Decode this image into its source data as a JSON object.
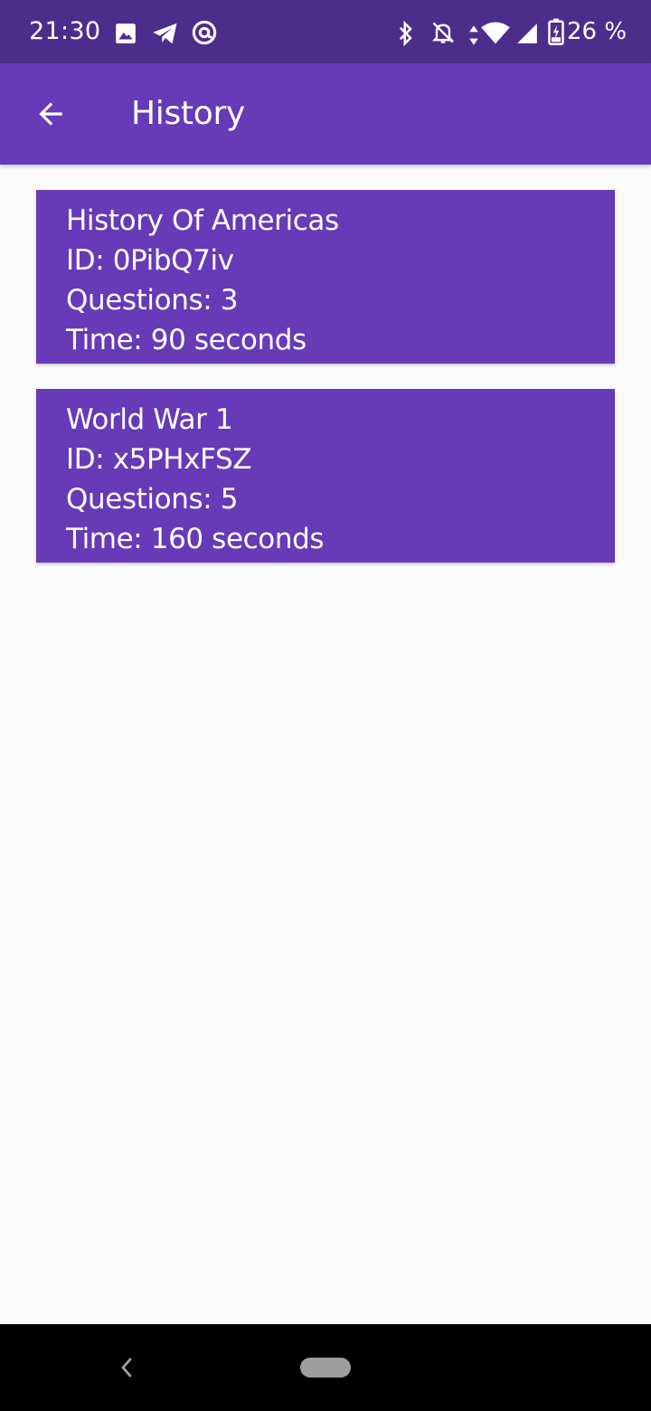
{
  "status_bar": {
    "time": "21:30",
    "battery": "26 %",
    "icons": [
      "image-icon",
      "telegram-icon",
      "at-sign-icon",
      "bluetooth-icon",
      "notifications-off-icon",
      "data-arrows-icon",
      "wifi-icon",
      "cell-signal-icon",
      "battery-charging-icon"
    ]
  },
  "app_bar": {
    "title": "History",
    "back_icon": "arrow-back-icon"
  },
  "quizzes": [
    {
      "title": "History Of Americas",
      "id": "ID: 0PibQ7iv",
      "questions": "Questions: 3",
      "time": "Time: 90 seconds"
    },
    {
      "title": "World War 1",
      "id": "ID: x5PHxFSZ",
      "questions": "Questions: 5",
      "time": "Time: 160 seconds"
    }
  ],
  "nav_bar": {
    "back_icon": "nav-back-chevron-icon",
    "home_icon": "home-pill-icon"
  },
  "colors": {
    "status_bar": "#4d2d8c",
    "primary": "#673ab7",
    "background": "#fafafa",
    "nav_bar": "#000000"
  }
}
